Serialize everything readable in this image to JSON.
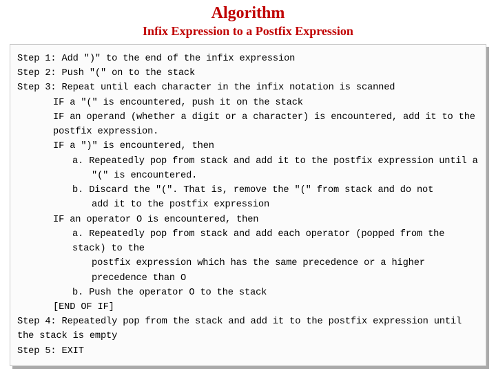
{
  "title": "Algorithm",
  "subtitle": "Infix Expression to a Postfix Expression",
  "steps": {
    "s1": "Step 1: Add \")\" to the end of the infix expression",
    "s2": "Step 2: Push \"(\" on to the stack",
    "s3": "Step 3: Repeat until each character in the infix notation is scanned",
    "s3_if1": "IF a \"(\" is encountered, push it on the stack",
    "s3_if2a": "IF an operand (whether a digit or a character) is encountered, add it to the",
    "s3_if2b": "postfix expression.",
    "s3_if3": "IF a \")\" is encountered, then",
    "s3_if3_a1": "a. Repeatedly pop from stack and add it to the postfix expression until a",
    "s3_if3_a2": "\"(\" is encountered.",
    "s3_if3_b1": "b. Discard the \"(\". That is, remove the \"(\" from stack and do not",
    "s3_if3_b2": "add it to the postfix expression",
    "s3_if4": "IF an operator O is encountered, then",
    "s3_if4_a1": "a. Repeatedly pop from stack and add each operator (popped from the stack) to the",
    "s3_if4_a2": "postfix expression which has the same precedence or a higher precedence than O",
    "s3_if4_b": "b. Push the operator O to the stack",
    "s3_endif": "[END OF IF]",
    "s4": "Step 4: Repeatedly pop from the stack and add it to the postfix expression until the stack is empty",
    "s5": "Step 5: EXIT"
  }
}
